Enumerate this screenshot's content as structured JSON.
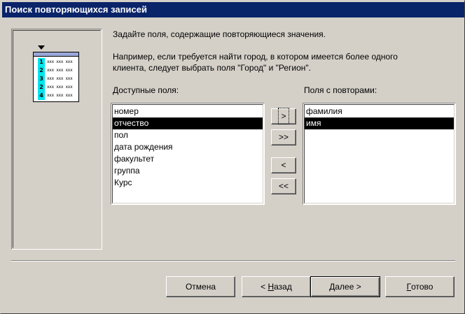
{
  "window": {
    "title": "Поиск повторяющихся записей"
  },
  "instructions": {
    "line1": "Задайте поля, содержащие повторяющиеся значения.",
    "line2": "Например, если требуется найти город, в котором имеется более одного",
    "line3": "клиента, следует выбрать поля \"Город\" и \"Регион\"."
  },
  "preview": {
    "row_numbers": [
      "1",
      "2",
      "3",
      "2",
      "4"
    ],
    "cell_text": "xxx xxx xxx"
  },
  "available": {
    "label": "Доступные поля:",
    "items": [
      "номер",
      "отчество",
      "пол",
      "дата рождения",
      "факультет",
      "группа",
      "Курс"
    ],
    "selected_index": 1
  },
  "repeated": {
    "label": "Поля с повторами:",
    "items": [
      "фамилия",
      "имя"
    ],
    "selected_index": 1
  },
  "move_buttons": {
    "add_one": ">",
    "add_all": ">>",
    "remove_one": "<",
    "remove_all": "<<"
  },
  "footer": {
    "cancel": "Отмена",
    "back_prefix": "< ",
    "back_underlined": "Н",
    "back_rest": "азад",
    "next_underlined": "Д",
    "next_rest": "алее >",
    "finish_underlined": "Г",
    "finish_rest": "отово"
  },
  "colors": {
    "titlebar": "#0a246a",
    "face": "#d4d0c8",
    "selection": "#000000",
    "preview_number_bg": "#00e5ee"
  }
}
